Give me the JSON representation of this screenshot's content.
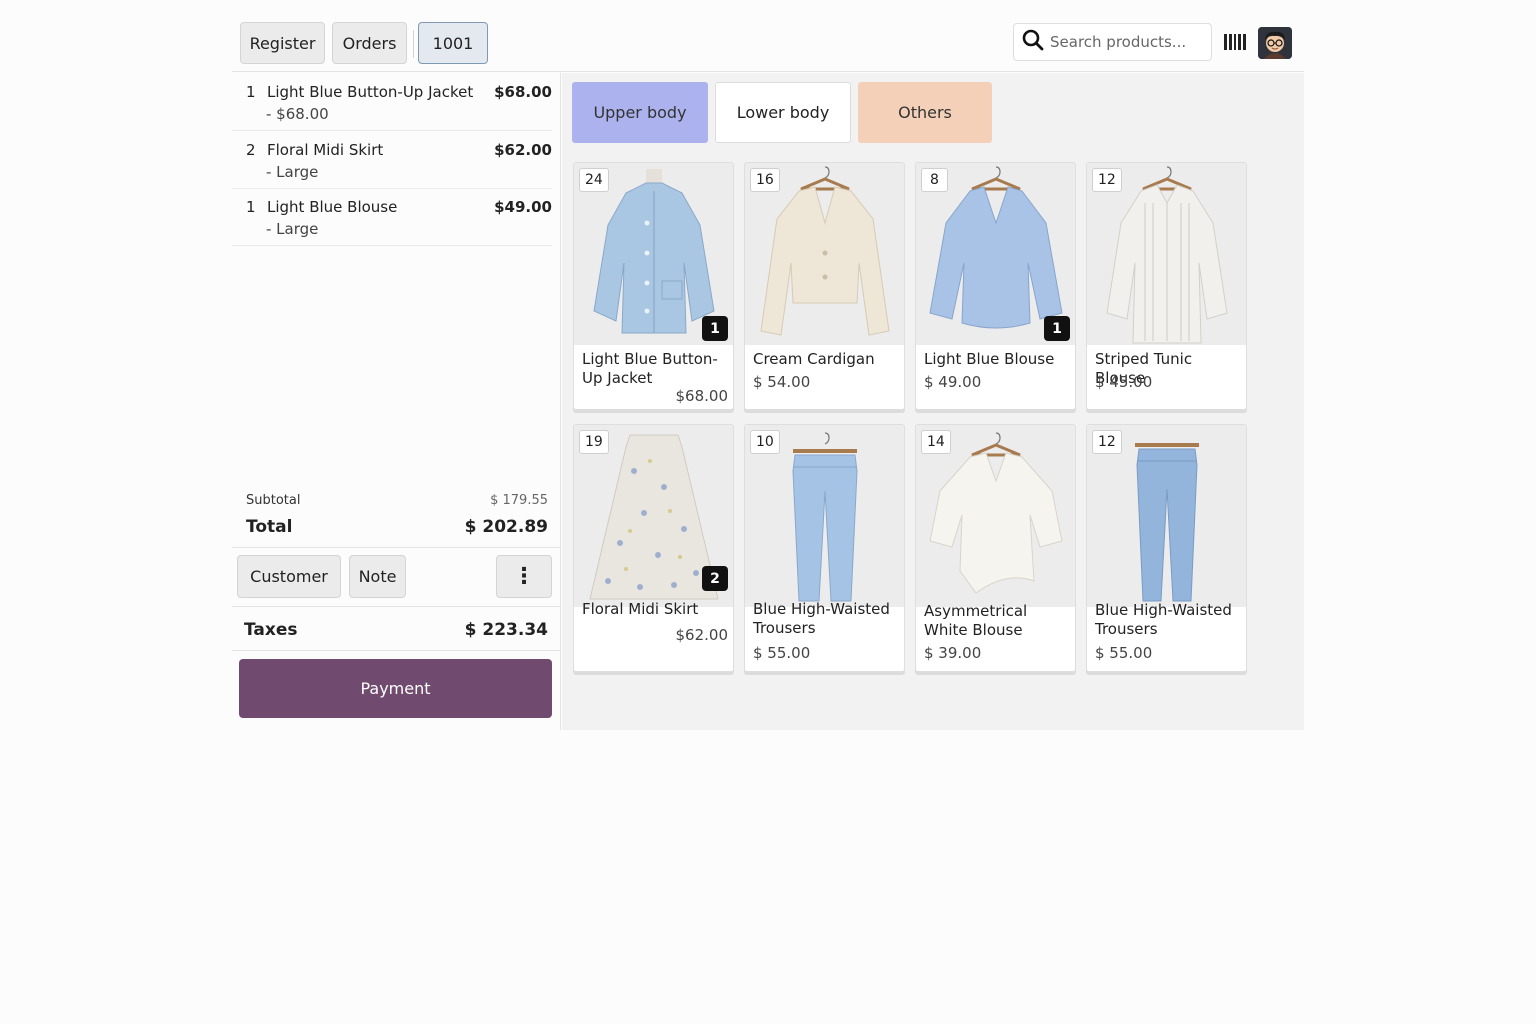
{
  "header": {
    "register_label": "Register",
    "orders_label": "Orders",
    "current_order_label": "1001",
    "search_placeholder": "Search products...",
    "icons": {
      "search": "search-icon",
      "barcode": "barcode-icon",
      "avatar": "user-avatar"
    }
  },
  "order": {
    "lines": [
      {
        "qty": "1",
        "name": "Light Blue Button-Up Jacket",
        "attr": "- $68.00",
        "price": "$68.00"
      },
      {
        "qty": "2",
        "name": "Floral Midi Skirt",
        "attr": "- Large",
        "price": "$62.00"
      },
      {
        "qty": "1",
        "name": "Light Blue Blouse",
        "attr": "- Large",
        "price": "$49.00"
      }
    ],
    "subtotal_label": "Subtotal",
    "subtotal_value": "$ 179.55",
    "total_label": "Total",
    "total_value": "$ 202.89",
    "customer_label": "Customer",
    "note_label": "Note",
    "more_label": "⋮",
    "taxes_label": "Taxes",
    "taxes_value": "$ 223.34",
    "payment_label": "Payment"
  },
  "categories": [
    {
      "label": "Upper body",
      "color": "#abb2ee"
    },
    {
      "label": "Lower body",
      "color": "#ffffff"
    },
    {
      "label": "Others",
      "color": "#f5d0b8"
    }
  ],
  "products": [
    {
      "name": "Light Blue Button-Up Jacket",
      "price": "$68.00",
      "stock": "24",
      "in_cart": "1",
      "color": "#a9c6e3"
    },
    {
      "name": "Cream Cardigan",
      "price": "$ 54.00",
      "stock": "16",
      "color": "#eee6d6"
    },
    {
      "name": "Light Blue Blouse",
      "price": "$ 49.00",
      "stock": "8",
      "in_cart": "1",
      "color": "#a8c3e6"
    },
    {
      "name": "Striped Tunic Blouse",
      "price": "$ 45.00",
      "stock": "12",
      "color": "#f1f0ec"
    },
    {
      "name": "Floral Midi Skirt",
      "price": "$62.00",
      "stock": "19",
      "in_cart": "2",
      "color": "#e9e6df"
    },
    {
      "name": "Blue High-Waisted Trousers",
      "price": "$ 55.00",
      "stock": "10",
      "color": "#a5c3e4"
    },
    {
      "name": "Asymmetrical White Blouse",
      "price": "$ 39.00",
      "stock": "14",
      "color": "#f6f4ef"
    },
    {
      "name": "Blue High-Waisted Trousers",
      "price": "$ 55.00",
      "stock": "12",
      "color": "#93b5dc"
    }
  ],
  "colors": {
    "accent": "#714b6f",
    "selected_order_border": "#7f99b4",
    "panel_bg": "#f2f2f3"
  }
}
